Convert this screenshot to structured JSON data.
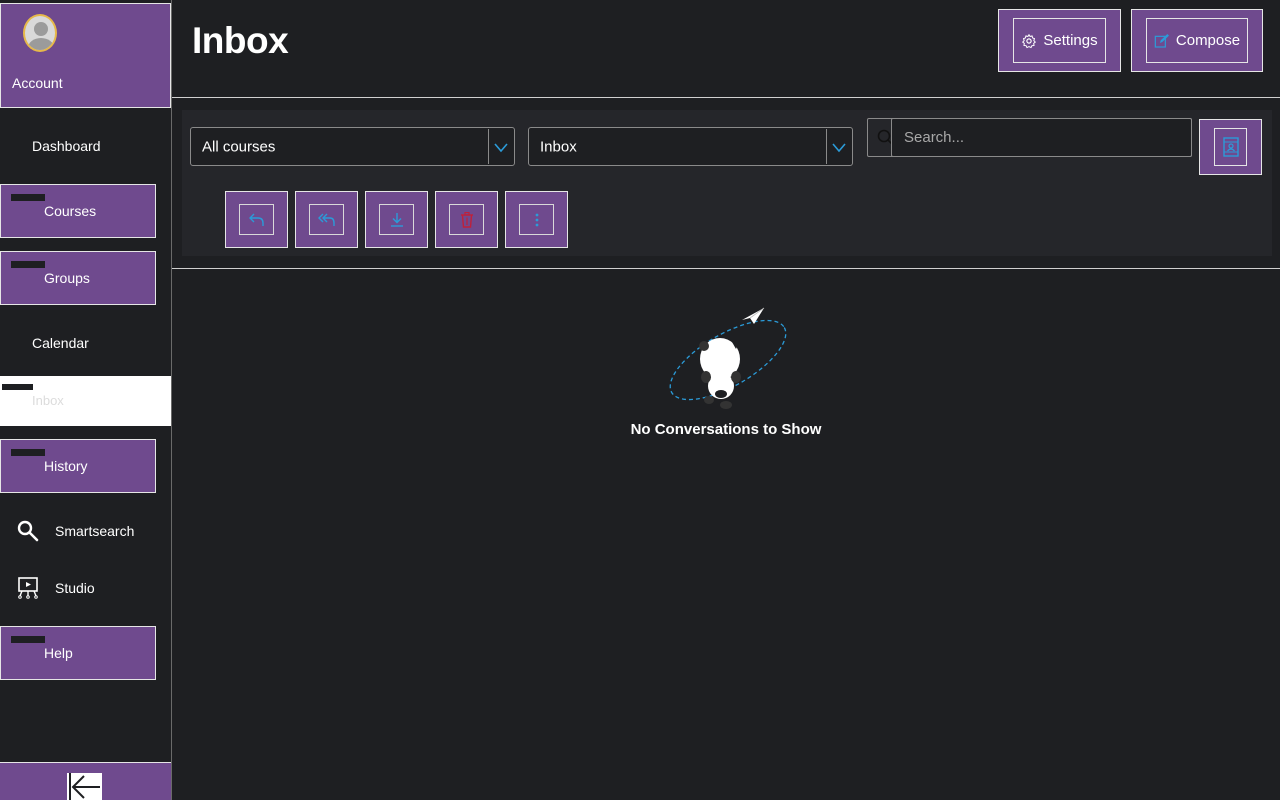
{
  "sidebar": {
    "account_label": "Account",
    "items": [
      {
        "label": "Dashboard"
      },
      {
        "label": "Courses"
      },
      {
        "label": "Groups"
      },
      {
        "label": "Calendar"
      },
      {
        "label": "Inbox"
      },
      {
        "label": "History"
      },
      {
        "label": "Smartsearch",
        "icon": "search-icon"
      },
      {
        "label": "Studio",
        "icon": "studio-icon"
      },
      {
        "label": "Help"
      }
    ],
    "collapse_icon": "collapse-arrow-icon"
  },
  "header": {
    "title": "Inbox",
    "settings_label": "Settings",
    "compose_label": "Compose"
  },
  "toolbar": {
    "course_filter": "All courses",
    "mailbox_filter": "Inbox",
    "search_placeholder": "Search...",
    "actions": [
      "reply-icon",
      "reply-all-icon",
      "archive-icon",
      "delete-icon",
      "more-icon"
    ]
  },
  "empty_state": {
    "message": "No Conversations to Show"
  },
  "colors": {
    "background": "#1e1f22",
    "accent": "#6f4a8e",
    "text": "#ffffff",
    "focus_blue": "#2b9bd8",
    "danger": "#c0203a"
  }
}
